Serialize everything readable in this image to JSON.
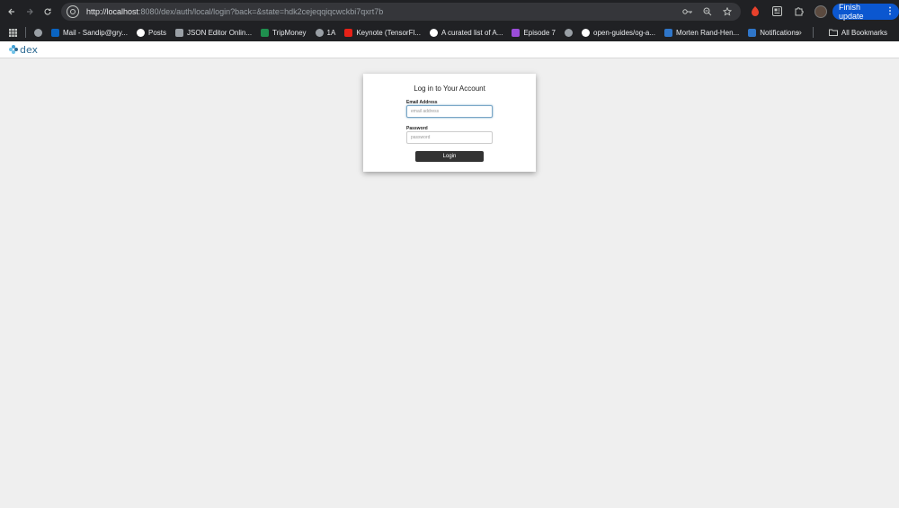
{
  "browser": {
    "url_host": "http://localhost",
    "url_path": ":8080/dex/auth/local/login?back=&state=hdk2cejeqqiqcwckbi7qxrt7b",
    "finish_update_label": "Finish update",
    "icons": [
      "back-icon",
      "forward-icon",
      "reload-icon",
      "site-info-icon",
      "password-key-icon",
      "zoom-icon",
      "bookmark-star-icon",
      "extension-red-icon",
      "extension-window-icon",
      "extensions-puzzle-icon",
      "profile-avatar-icon",
      "menu-kebab-icon"
    ]
  },
  "bookmarks": [
    {
      "label": "",
      "icon": "globe-icon",
      "color": "#9aa0a6"
    },
    {
      "label": "Mail - Sandip@gry...",
      "icon": "outlook-icon",
      "color": "#0a64c2"
    },
    {
      "label": "Posts",
      "icon": "circle-icon",
      "color": "#ffffff"
    },
    {
      "label": "JSON Editor Onlin...",
      "icon": "braces-icon",
      "color": "#9aa0a6"
    },
    {
      "label": "TripMoney",
      "icon": "tripmoney-icon",
      "color": "#1f8f4e"
    },
    {
      "label": "1A",
      "icon": "globe-icon",
      "color": "#9aa0a6"
    },
    {
      "label": "Keynote (TensorFl...",
      "icon": "youtube-icon",
      "color": "#e62117"
    },
    {
      "label": "A curated list of A...",
      "icon": "github-icon",
      "color": "#ffffff"
    },
    {
      "label": "Episode 7",
      "icon": "play-icon",
      "color": "#9b4dd9"
    },
    {
      "label": "",
      "icon": "globe-icon",
      "color": "#9aa0a6"
    },
    {
      "label": "open-guides/og-a...",
      "icon": "github-icon",
      "color": "#ffffff"
    },
    {
      "label": "Morten Rand-Hen...",
      "icon": "video-icon",
      "color": "#2f76c9"
    },
    {
      "label": "Notifications",
      "icon": "linkedin-icon",
      "color": "#2f76c9"
    }
  ],
  "bookmarks_more": "»",
  "all_bookmarks_label": "All Bookmarks",
  "page": {
    "logo_text": "dex",
    "title": "Log in to Your Account",
    "email_label": "Email Address",
    "email_placeholder": "email address",
    "password_label": "Password",
    "password_placeholder": "password",
    "login_label": "Login"
  },
  "colors": {
    "accent": "#0b57d0",
    "page_bg": "#efefef",
    "button_bg": "#333333"
  }
}
